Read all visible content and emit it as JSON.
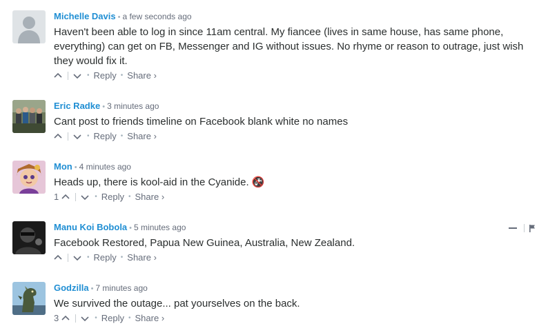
{
  "ui": {
    "separator": "•",
    "reply_label": "Reply",
    "share_label": "Share ›"
  },
  "comments": [
    {
      "author": "Michelle Davis",
      "time": "a few seconds ago",
      "text": "Haven't been able to log in since 11am central. My fiancee (lives in same house, has same phone, everything) can get on FB, Messenger and IG without issues. No rhyme or reason to outrage, just wish they would fix it.",
      "votes": ""
    },
    {
      "author": "Eric Radke",
      "time": "3 minutes ago",
      "text": "Cant post to friends timeline on Facebook blank white no names",
      "votes": ""
    },
    {
      "author": "Mon",
      "time": "4 minutes ago",
      "text": "Heads up, there is kool-aid in the Cyanide. 🚱",
      "votes": "1"
    },
    {
      "author": "Manu Koi Bobola",
      "time": "5 minutes ago",
      "text": "Facebook Restored, Papua New Guinea, Australia, New Zealand.",
      "votes": ""
    },
    {
      "author": "Godzilla",
      "time": "7 minutes ago",
      "text": "We survived the outage... pat yourselves on the back.",
      "votes": "3"
    }
  ]
}
